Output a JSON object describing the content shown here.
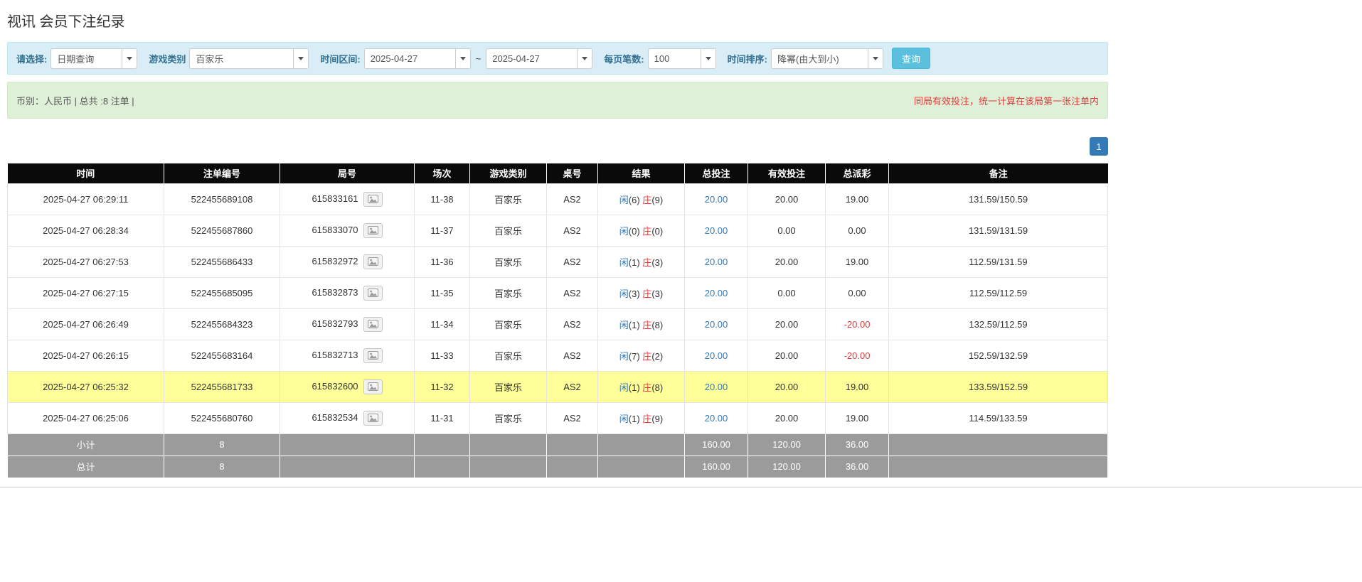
{
  "page": {
    "title": "视讯 会员下注纪录"
  },
  "colors": {
    "accent": "#337ab7",
    "red": "#e03c3c",
    "highlight": "#ffff99",
    "header_bg": "#0a0a0a",
    "footer_bg": "#9b9b9b",
    "filter_bg": "#d9edf7",
    "filter_border": "#bce8f1",
    "filter_label": "#31708f",
    "summary_bg": "#dff0d8",
    "summary_border": "#d6e9c6",
    "btn": "#5bc0de",
    "btn_border": "#46b8da"
  },
  "filters": {
    "select_label": "请选择:",
    "select_value": "日期查询",
    "game_type_label": "游戏类别",
    "game_type_value": "百家乐",
    "time_range_label": "时间区间:",
    "date_from": "2025-04-27",
    "tilde": "~",
    "date_to": "2025-04-27",
    "page_size_label": "每页笔数:",
    "page_size_value": "100",
    "sort_label": "时间排序:",
    "sort_value": "降幂(由大到小)",
    "search_button": "查询"
  },
  "summary": {
    "left": "币别：人民币 | 总共 :8 注单 |",
    "right": "同局有效投注，统一计算在该局第一张注单内"
  },
  "pagination": {
    "page": "1"
  },
  "icons": {
    "dropdown": "caret-down-icon",
    "round_detail": "picture-icon"
  },
  "table": {
    "headers": [
      "时间",
      "注单编号",
      "局号",
      "场次",
      "游戏类别",
      "桌号",
      "结果",
      "总投注",
      "有效投注",
      "总派彩",
      "备注"
    ],
    "result_labels": {
      "player": "闲",
      "banker": "庄"
    },
    "rows": [
      {
        "time": "2025-04-27 06:29:11",
        "bet_id": "522455689108",
        "round_id": "615833161",
        "session": "11-38",
        "game_type": "百家乐",
        "table_no": "AS2",
        "player": "6",
        "banker": "9",
        "total_bet": "20.00",
        "valid_bet": "20.00",
        "payout": "19.00",
        "note": "131.59/150.59",
        "highlighted": false
      },
      {
        "time": "2025-04-27 06:28:34",
        "bet_id": "522455687860",
        "round_id": "615833070",
        "session": "11-37",
        "game_type": "百家乐",
        "table_no": "AS2",
        "player": "0",
        "banker": "0",
        "total_bet": "20.00",
        "valid_bet": "0.00",
        "payout": "0.00",
        "note": "131.59/131.59",
        "highlighted": false
      },
      {
        "time": "2025-04-27 06:27:53",
        "bet_id": "522455686433",
        "round_id": "615832972",
        "session": "11-36",
        "game_type": "百家乐",
        "table_no": "AS2",
        "player": "1",
        "banker": "3",
        "total_bet": "20.00",
        "valid_bet": "20.00",
        "payout": "19.00",
        "note": "112.59/131.59",
        "highlighted": false
      },
      {
        "time": "2025-04-27 06:27:15",
        "bet_id": "522455685095",
        "round_id": "615832873",
        "session": "11-35",
        "game_type": "百家乐",
        "table_no": "AS2",
        "player": "3",
        "banker": "3",
        "total_bet": "20.00",
        "valid_bet": "0.00",
        "payout": "0.00",
        "note": "112.59/112.59",
        "highlighted": false
      },
      {
        "time": "2025-04-27 06:26:49",
        "bet_id": "522455684323",
        "round_id": "615832793",
        "session": "11-34",
        "game_type": "百家乐",
        "table_no": "AS2",
        "player": "1",
        "banker": "8",
        "total_bet": "20.00",
        "valid_bet": "20.00",
        "payout": "-20.00",
        "note": "132.59/112.59",
        "highlighted": false
      },
      {
        "time": "2025-04-27 06:26:15",
        "bet_id": "522455683164",
        "round_id": "615832713",
        "session": "11-33",
        "game_type": "百家乐",
        "table_no": "AS2",
        "player": "7",
        "banker": "2",
        "total_bet": "20.00",
        "valid_bet": "20.00",
        "payout": "-20.00",
        "note": "152.59/132.59",
        "highlighted": false
      },
      {
        "time": "2025-04-27 06:25:32",
        "bet_id": "522455681733",
        "round_id": "615832600",
        "session": "11-32",
        "game_type": "百家乐",
        "table_no": "AS2",
        "player": "1",
        "banker": "8",
        "total_bet": "20.00",
        "valid_bet": "20.00",
        "payout": "19.00",
        "note": "133.59/152.59",
        "highlighted": true
      },
      {
        "time": "2025-04-27 06:25:06",
        "bet_id": "522455680760",
        "round_id": "615832534",
        "session": "11-31",
        "game_type": "百家乐",
        "table_no": "AS2",
        "player": "1",
        "banker": "9",
        "total_bet": "20.00",
        "valid_bet": "20.00",
        "payout": "19.00",
        "note": "114.59/133.59",
        "highlighted": false
      }
    ],
    "footer_rows": [
      {
        "name": "subtotal-row",
        "label": "小计",
        "count": "8",
        "total_bet": "160.00",
        "valid_bet": "120.00",
        "payout": "36.00"
      },
      {
        "name": "total-row",
        "label": "总计",
        "count": "8",
        "total_bet": "160.00",
        "valid_bet": "120.00",
        "payout": "36.00"
      }
    ]
  }
}
